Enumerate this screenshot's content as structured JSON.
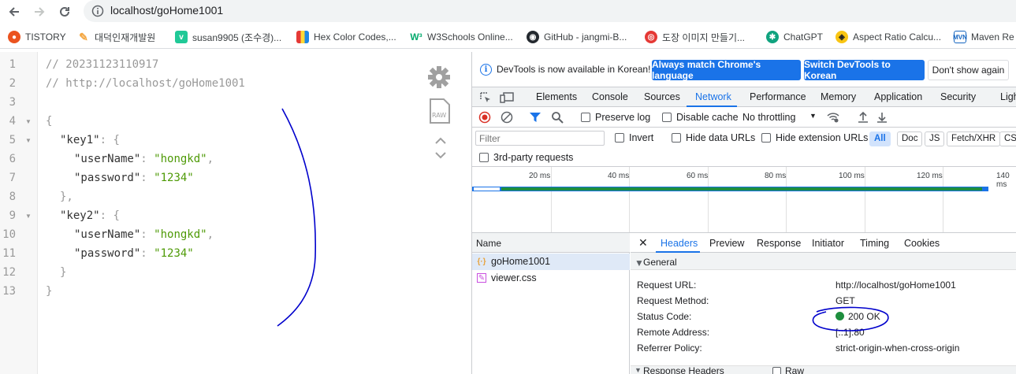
{
  "browser": {
    "url": "localhost/goHome1001",
    "bookmarks": [
      {
        "label": "TISTORY",
        "icon": "tistory-icon",
        "color": "#eb531f"
      },
      {
        "label": "대덕인재개발원",
        "icon": "brush-icon",
        "color": "#f4a742"
      },
      {
        "label": "susan9905 (조수경)...",
        "icon": "velog-icon",
        "color": "#20c997"
      },
      {
        "label": "Hex Color Codes,...",
        "icon": "palette-icon",
        "color": "#6f42c1"
      },
      {
        "label": "W3Schools Online...",
        "icon": "w3schools-icon",
        "color": "#04aa6d"
      },
      {
        "label": "GitHub - jangmi-B...",
        "icon": "github-icon",
        "color": "#24292f"
      },
      {
        "label": "도장 이미지 만들기...",
        "icon": "stamp-icon",
        "color": "#e53935"
      },
      {
        "label": "ChatGPT",
        "icon": "chatgpt-icon",
        "color": "#10a37f"
      },
      {
        "label": "Aspect Ratio Calcu...",
        "icon": "aspect-ratio-icon",
        "color": "#f9c513"
      },
      {
        "label": "Maven Re",
        "icon": "maven-icon",
        "color": "#1565c0"
      }
    ]
  },
  "json_viewer": {
    "line_numbers": [
      "1",
      "2",
      "3",
      "4",
      "5",
      "6",
      "7",
      "8",
      "9",
      "10",
      "11",
      "12",
      "13"
    ],
    "comment1": "// 20231123110917",
    "comment2": "// http://localhost/goHome1001",
    "open_brace": "{",
    "close_brace": "}",
    "key1": "\"key1\"",
    "key2": "\"key2\"",
    "username_key": "\"userName\"",
    "password_key": "\"password\"",
    "username_val": "\"hongkd\"",
    "password_val": "\"1234\"",
    "inner_open": "{",
    "inner_close_comma": "},",
    "inner_close": "}",
    "colon": ": ",
    "comma": ","
  },
  "devtools": {
    "infobar": {
      "text": "DevTools is now available in Korean!",
      "btn_match": "Always match Chrome's language",
      "btn_switch": "Switch DevTools to Korean",
      "btn_dismiss": "Don't show again"
    },
    "tabs": [
      "Elements",
      "Console",
      "Sources",
      "Network",
      "Performance",
      "Memory",
      "Application",
      "Security",
      "Ligh"
    ],
    "toolbar": {
      "preserve_log": "Preserve log",
      "disable_cache": "Disable cache",
      "throttling": "No throttling",
      "filter_placeholder": "Filter",
      "invert": "Invert",
      "hide_data_urls": "Hide data URLs",
      "hide_ext_urls": "Hide extension URLs",
      "types": [
        "All",
        "Doc",
        "JS",
        "Fetch/XHR",
        "CSS"
      ],
      "third_party": "3rd-party requests"
    },
    "timeline_ticks": [
      "20 ms",
      "40 ms",
      "60 ms",
      "80 ms",
      "100 ms",
      "120 ms",
      "140 ms"
    ],
    "requests": {
      "header": "Name",
      "items": [
        {
          "name": "goHome1001",
          "icon": "json-file-icon"
        },
        {
          "name": "viewer.css",
          "icon": "css-file-icon"
        }
      ]
    },
    "detail": {
      "close": "✕",
      "tabs": [
        "Headers",
        "Preview",
        "Response",
        "Initiator",
        "Timing",
        "Cookies"
      ],
      "general_title": "General",
      "rows": [
        {
          "key": "Request URL:",
          "value": "http://localhost/goHome1001"
        },
        {
          "key": "Request Method:",
          "value": "GET"
        },
        {
          "key": "Status Code:",
          "value": "200 OK"
        },
        {
          "key": "Remote Address:",
          "value": "[::1]:80"
        },
        {
          "key": "Referrer Policy:",
          "value": "strict-origin-when-cross-origin"
        }
      ],
      "response_headers": "Response Headers",
      "raw": "Raw"
    }
  },
  "colors": {
    "accent": "#1a73e8",
    "status_ok": "#1e8e3e",
    "ink": "#0000cc"
  }
}
